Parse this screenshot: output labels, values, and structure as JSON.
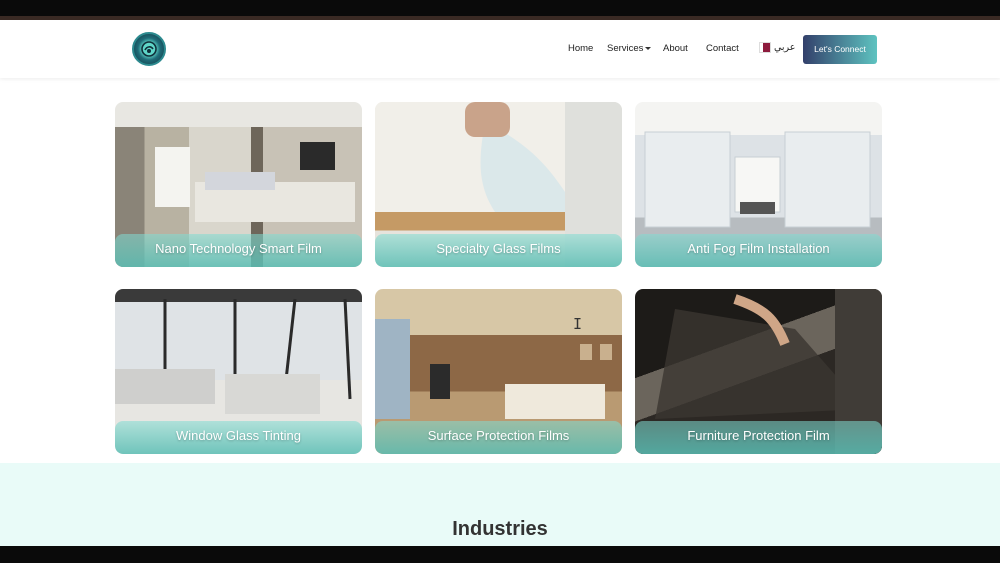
{
  "nav": {
    "home": "Home",
    "services": "Services",
    "about": "About",
    "contact": "Contact",
    "language": "عربي",
    "cta": "Let's Connect"
  },
  "services": [
    {
      "title": "Nano Technology Smart Film"
    },
    {
      "title": "Specialty Glass Films"
    },
    {
      "title": "Anti Fog Film Installation"
    },
    {
      "title": "Window Glass Tinting"
    },
    {
      "title": "Surface Protection Films"
    },
    {
      "title": "Furniture Protection Film"
    }
  ],
  "industries": {
    "title": "Industries"
  },
  "colors": {
    "accent_start": "#33406b",
    "accent_end": "#5ec3c0",
    "section_bg": "#e9fbf8"
  },
  "icons": {
    "logo": "logo-emblem",
    "language": "qatar-flag-icon",
    "services": "chevron-down-icon",
    "cursor": "text-cursor-icon"
  }
}
